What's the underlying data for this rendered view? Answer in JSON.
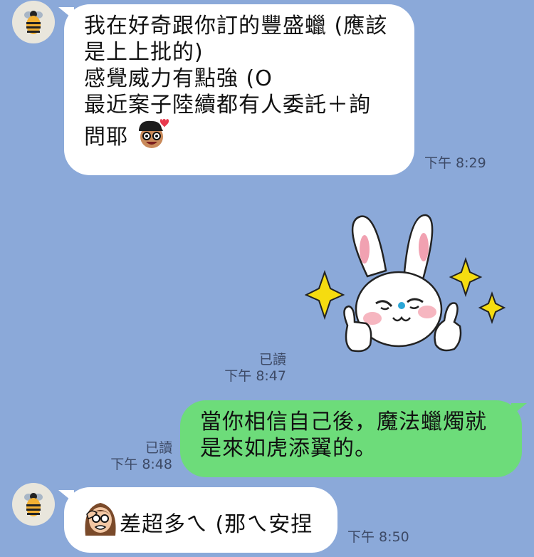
{
  "messages": [
    {
      "sender": "them",
      "lines": [
        "我在好奇跟你訂的豐盛蠟 (應該",
        "是上上批的)",
        "感覺威力有點強 (O",
        "最近案子陸續都有人委託＋詢",
        "問耶"
      ],
      "emoji": "smiling-guy-with-heart-emoji",
      "time": "下午 8:29"
    },
    {
      "sender": "me",
      "type": "sticker",
      "sticker": "white-rabbit-thumbs-up-sticker",
      "read": "已讀",
      "time": "下午 8:47"
    },
    {
      "sender": "me",
      "lines": [
        "當你相信自己後，魔法蠟燭就",
        "是來如虎添翼的。"
      ],
      "read": "已讀",
      "time": "下午 8:48"
    },
    {
      "sender": "them",
      "emoji": "facepalm-woman-emoji",
      "lines": [
        "差超多ㄟ (那ㄟ安捏"
      ],
      "time": "下午 8:50"
    }
  ],
  "avatar_icon": "bee-icon",
  "colors": {
    "background": "#8ba9d9",
    "incoming_bubble": "#ffffff",
    "outgoing_bubble": "#6ddc7a",
    "meta_text": "#3d4a66"
  }
}
